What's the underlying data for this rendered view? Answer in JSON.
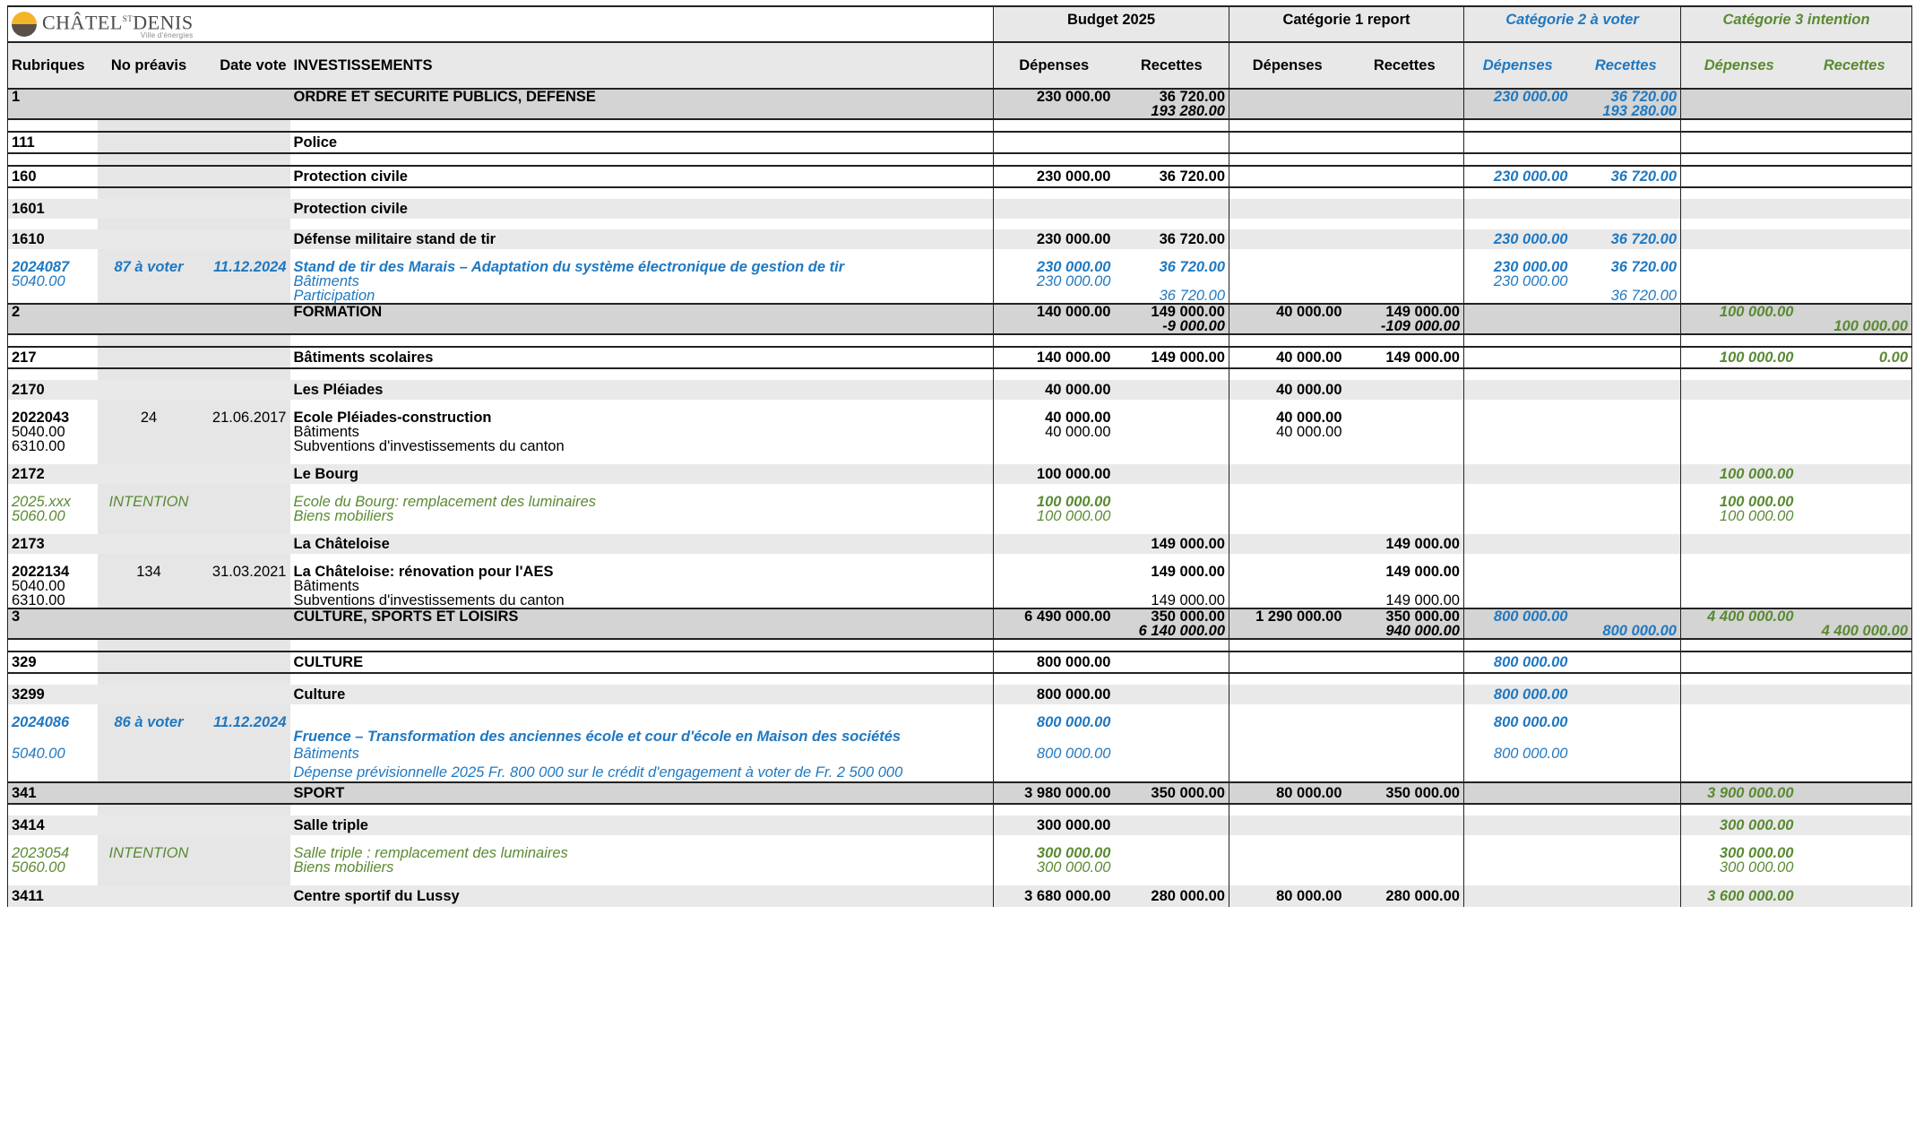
{
  "brand": {
    "logo_text": "CHÂTEL",
    "logo_sup": "ST",
    "logo_text2": "DENIS",
    "logo_sub": "Ville d'énergies"
  },
  "header": {
    "budget": "Budget 2025",
    "cat1": "Catégorie 1 report",
    "cat2": "Catégorie 2 à voter",
    "cat3": "Catégorie 3 intention",
    "rubriques": "Rubriques",
    "preavis": "No préavis",
    "date_vote": "Date vote",
    "investissements": "INVESTISSEMENTS",
    "depenses": "Dépenses",
    "recettes": "Recettes"
  },
  "rows": [
    {
      "k": "r1",
      "code": "1",
      "label": "ORDRE ET SECURITE PUBLICS, DEFENSE",
      "bd": "230 000.00",
      "br": "36 720.00",
      "c2d": "230 000.00",
      "c2r": "36 720.00"
    },
    {
      "k": "r1b",
      "br": "193 280.00",
      "c2r": "193 280.00"
    },
    {
      "k": "r111",
      "code": "111",
      "label": "Police"
    },
    {
      "k": "r160",
      "code": "160",
      "label": "Protection civile",
      "bd": "230 000.00",
      "br": "36 720.00",
      "c2d": "230 000.00",
      "c2r": "36 720.00"
    },
    {
      "k": "r1601",
      "code": "1601",
      "label": "Protection civile"
    },
    {
      "k": "r1610",
      "code": "1610",
      "label": "Défense militaire stand de tir",
      "bd": "230 000.00",
      "br": "36 720.00",
      "c2d": "230 000.00",
      "c2r": "36 720.00"
    },
    {
      "k": "r2024087",
      "code": "2024087",
      "preavis": "87 à voter",
      "date": "11.12.2024",
      "label": "Stand de tir des Marais – Adaptation du système électronique de gestion de tir",
      "bd": "230 000.00",
      "br": "36 720.00",
      "c2d": "230 000.00",
      "c2r": "36 720.00"
    },
    {
      "k": "r5040a",
      "code": "5040.00",
      "label": "Bâtiments",
      "bd": "230 000.00",
      "c2d": "230 000.00"
    },
    {
      "k": "rpart",
      "label": "Participation",
      "br": "36 720.00",
      "c2r": "36 720.00"
    },
    {
      "k": "r2",
      "code": "2",
      "label": "FORMATION",
      "bd": "140 000.00",
      "br": "149 000.00",
      "c1d": "40 000.00",
      "c1r": "149 000.00",
      "c3d": "100 000.00"
    },
    {
      "k": "r2b",
      "br": "-9 000.00",
      "c1r": "-109 000.00",
      "c3r": "100 000.00"
    },
    {
      "k": "r217",
      "code": "217",
      "label": "Bâtiments scolaires",
      "bd": "140 000.00",
      "br": "149 000.00",
      "c1d": "40 000.00",
      "c1r": "149 000.00",
      "c3d": "100 000.00",
      "c3r": "0.00"
    },
    {
      "k": "r2170",
      "code": "2170",
      "label": "Les Pléiades",
      "bd": "40 000.00",
      "c1d": "40 000.00"
    },
    {
      "k": "r2022043",
      "code": "2022043",
      "preavis": "24",
      "date": "21.06.2017",
      "label": "Ecole Pléiades-construction",
      "bd": "40 000.00",
      "c1d": "40 000.00"
    },
    {
      "k": "r5040b",
      "code": "5040.00",
      "label": "Bâtiments",
      "bd": "40 000.00",
      "c1d": "40 000.00"
    },
    {
      "k": "r6310a",
      "code": "6310.00",
      "label": "Subventions d'investissements du canton"
    },
    {
      "k": "r2172",
      "code": "2172",
      "label": "Le Bourg",
      "bd": "100 000.00",
      "c3d": "100 000.00"
    },
    {
      "k": "r2025xxx",
      "code": "2025.xxx",
      "preavis": "INTENTION",
      "label": "Ecole du Bourg:  remplacement des luminaires",
      "bd": "100 000.00",
      "c3d": "100 000.00"
    },
    {
      "k": "r5060a",
      "code": "5060.00",
      "label": "Biens mobiliers",
      "bd": "100 000.00",
      "c3d": "100 000.00"
    },
    {
      "k": "r2173",
      "code": "2173",
      "label": "La Châteloise",
      "br": "149 000.00",
      "c1r": "149 000.00"
    },
    {
      "k": "r2022134",
      "code": "2022134",
      "preavis": "134",
      "date": "31.03.2021",
      "label": "La Châteloise: rénovation pour l'AES",
      "br": "149 000.00",
      "c1r": "149 000.00"
    },
    {
      "k": "r5040c",
      "code": "5040.00",
      "label": "Bâtiments"
    },
    {
      "k": "r6310b",
      "code": "6310.00",
      "label": "Subventions d'investissements du canton",
      "br": "149 000.00",
      "c1r": "149 000.00"
    },
    {
      "k": "r3",
      "code": "3",
      "label": "CULTURE, SPORTS ET LOISIRS",
      "bd": "6 490 000.00",
      "br": "350 000.00",
      "c1d": "1 290 000.00",
      "c1r": "350 000.00",
      "c2d": "800 000.00",
      "c3d": "4 400 000.00"
    },
    {
      "k": "r3b",
      "br": "6 140 000.00",
      "c1r": "940 000.00",
      "c2r": "800 000.00",
      "c3r": "4 400 000.00"
    },
    {
      "k": "r329",
      "code": "329",
      "label": "CULTURE",
      "bd": "800 000.00",
      "c2d": "800 000.00"
    },
    {
      "k": "r3299",
      "code": "3299",
      "label": "Culture",
      "bd": "800 000.00",
      "c2d": "800 000.00"
    },
    {
      "k": "r2024086",
      "code": "2024086",
      "preavis": "86 à voter",
      "date": "11.12.2024",
      "bd": "800 000.00",
      "c2d": "800 000.00"
    },
    {
      "k": "rfruence",
      "label": "Fruence – Transformation des anciennes école et cour d'école en Maison des sociétés"
    },
    {
      "k": "r5040d",
      "code": "5040.00",
      "label": "Bâtiments",
      "bd": "800 000.00",
      "c2d": "800 000.00"
    },
    {
      "k": "rdep",
      "label": "Dépense prévisionnelle 2025 Fr. 800 000 sur le crédit d'engagement à voter de  Fr. 2 500 000"
    },
    {
      "k": "r341",
      "code": "341",
      "label": "SPORT",
      "bd": "3 980 000.00",
      "br": "350 000.00",
      "c1d": "80 000.00",
      "c1r": "350 000.00",
      "c3d": "3 900 000.00"
    },
    {
      "k": "r3414",
      "code": "3414",
      "label": "Salle triple",
      "bd": "300 000.00",
      "c3d": "300 000.00"
    },
    {
      "k": "r2023054",
      "code": "2023054",
      "preavis": "INTENTION",
      "label": "Salle triple : remplacement des luminaires",
      "bd": "300 000.00",
      "c3d": "300 000.00"
    },
    {
      "k": "r5060b",
      "code": "5060.00",
      "label": "Biens mobiliers",
      "bd": "300 000.00",
      "c3d": "300 000.00"
    },
    {
      "k": "r3411",
      "code": "3411",
      "label": "Centre sportif du Lussy",
      "bd": "3 680 000.00",
      "br": "280 000.00",
      "c1d": "80 000.00",
      "c1r": "280 000.00",
      "c3d": "3 600 000.00"
    }
  ]
}
